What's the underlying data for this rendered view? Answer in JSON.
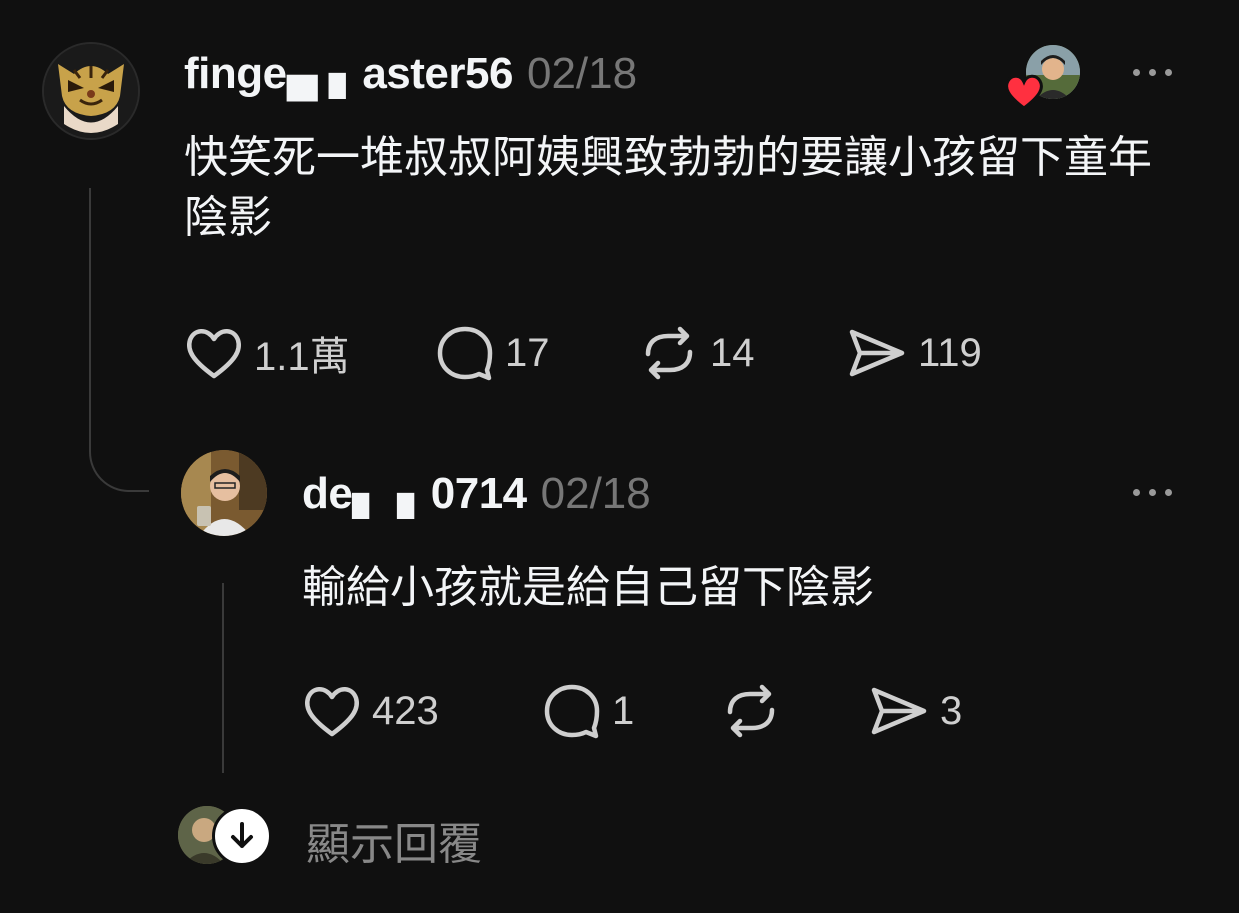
{
  "colors": {
    "background": "#101010",
    "text_primary": "#f3f5f7",
    "text_secondary": "#777777",
    "heart": "#ff3040",
    "thread_line": "#3a3a3a"
  },
  "post": {
    "username": "finge▄ ▖aster56",
    "date": "02/18",
    "text": "快笑死一堆叔叔阿姨興致勃勃的要讓小孩留下童年陰影",
    "likes": "1.1萬",
    "comments": "17",
    "reposts": "14",
    "shares": "119",
    "avatar_icon": "tiger-mask-avatar",
    "liked_by_icon": "heart-icon"
  },
  "reply": {
    "username": "de▖ ▖0714",
    "date": "02/18",
    "text": "輸給小孩就是給自己留下陰影",
    "likes": "423",
    "comments": "1",
    "reposts": "",
    "shares": "3",
    "avatar_icon": "person-photo-avatar"
  },
  "show_replies": {
    "label": "顯示回覆",
    "icon": "arrow-down-icon"
  }
}
